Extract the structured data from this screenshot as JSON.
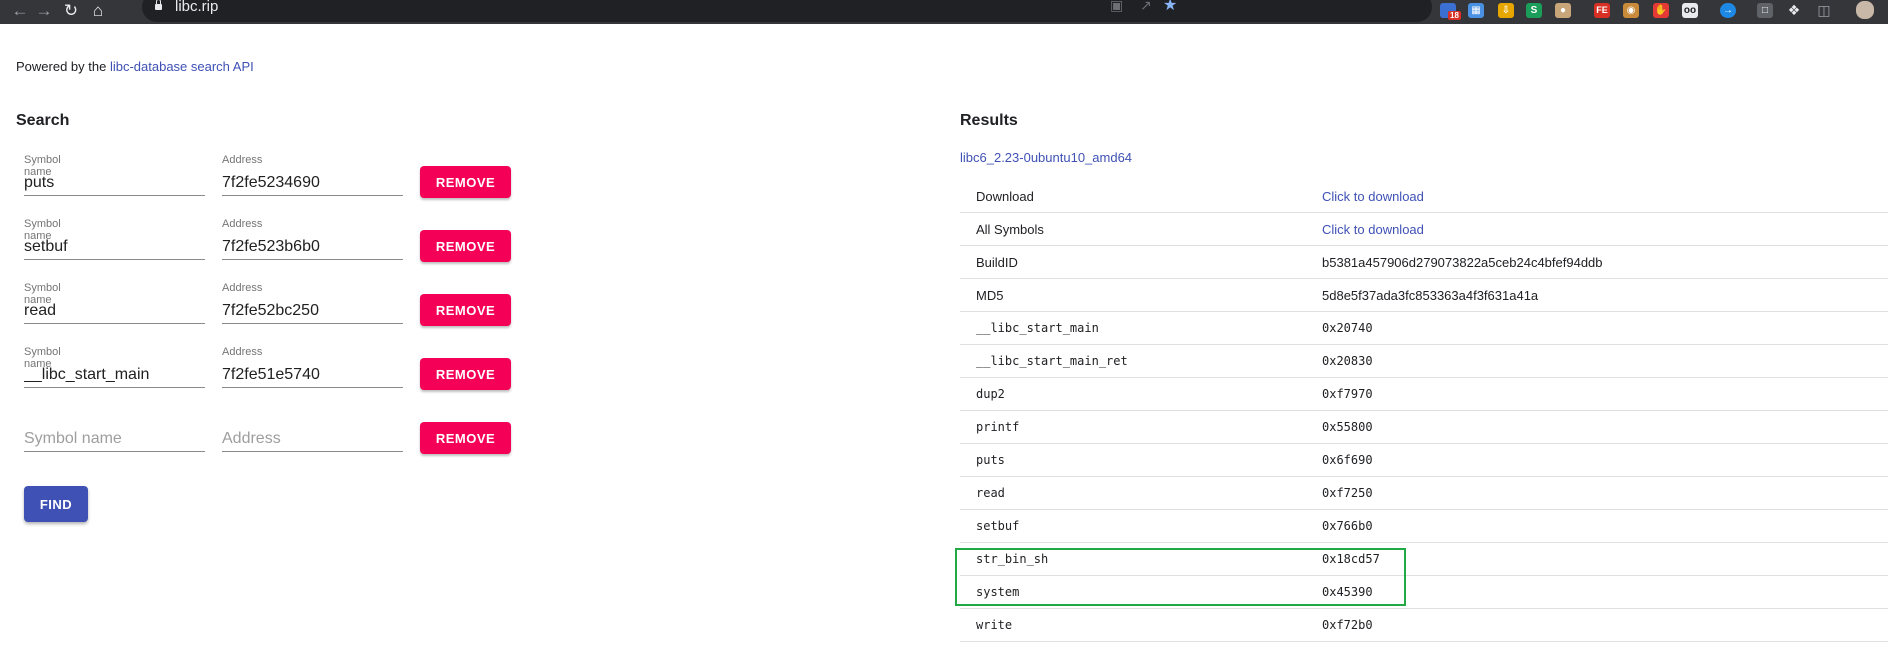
{
  "browser": {
    "url": "libc.rip",
    "extension_badge": "18"
  },
  "header": {
    "powered_prefix": "Powered by the ",
    "powered_link": "libc-database search API"
  },
  "search": {
    "title": "Search",
    "rows": [
      {
        "symbol_label": "Symbol name",
        "symbol_value": "puts",
        "address_label": "Address",
        "address_value": "7f2fe5234690",
        "remove_label": "REMOVE"
      },
      {
        "symbol_label": "Symbol name",
        "symbol_value": "setbuf",
        "address_label": "Address",
        "address_value": "7f2fe523b6b0",
        "remove_label": "REMOVE"
      },
      {
        "symbol_label": "Symbol name",
        "symbol_value": "read",
        "address_label": "Address",
        "address_value": "7f2fe52bc250",
        "remove_label": "REMOVE"
      },
      {
        "symbol_label": "Symbol name",
        "symbol_value": "__libc_start_main",
        "address_label": "Address",
        "address_value": "7f2fe51e5740",
        "remove_label": "REMOVE"
      }
    ],
    "empty_row": {
      "symbol_placeholder": "Symbol name",
      "address_placeholder": "Address",
      "remove_label": "REMOVE"
    },
    "find_label": "FIND"
  },
  "results": {
    "title": "Results",
    "lib_name": "libc6_2.23-0ubuntu10_amd64",
    "rows": [
      {
        "key": "Download",
        "value": "Click to download"
      },
      {
        "key": "All Symbols",
        "value": "Click to download"
      },
      {
        "key": "BuildID",
        "value": "b5381a457906d279073822a5ceb24c4bfef94ddb"
      },
      {
        "key": "MD5",
        "value": "5d8e5f37ada3fc853363a4f3f631a41a"
      },
      {
        "key": "__libc_start_main",
        "value": "0x20740"
      },
      {
        "key": "__libc_start_main_ret",
        "value": "0x20830"
      },
      {
        "key": "dup2",
        "value": "0xf7970"
      },
      {
        "key": "printf",
        "value": "0x55800"
      },
      {
        "key": "puts",
        "value": "0x6f690"
      },
      {
        "key": "read",
        "value": "0xf7250"
      },
      {
        "key": "setbuf",
        "value": "0x766b0"
      },
      {
        "key": "str_bin_sh",
        "value": "0x18cd57"
      },
      {
        "key": "system",
        "value": "0x45390"
      },
      {
        "key": "write",
        "value": "0xf72b0"
      }
    ]
  },
  "colors": {
    "primary": "#3f51b5",
    "accent": "#f50057",
    "highlight": "#22a845"
  }
}
